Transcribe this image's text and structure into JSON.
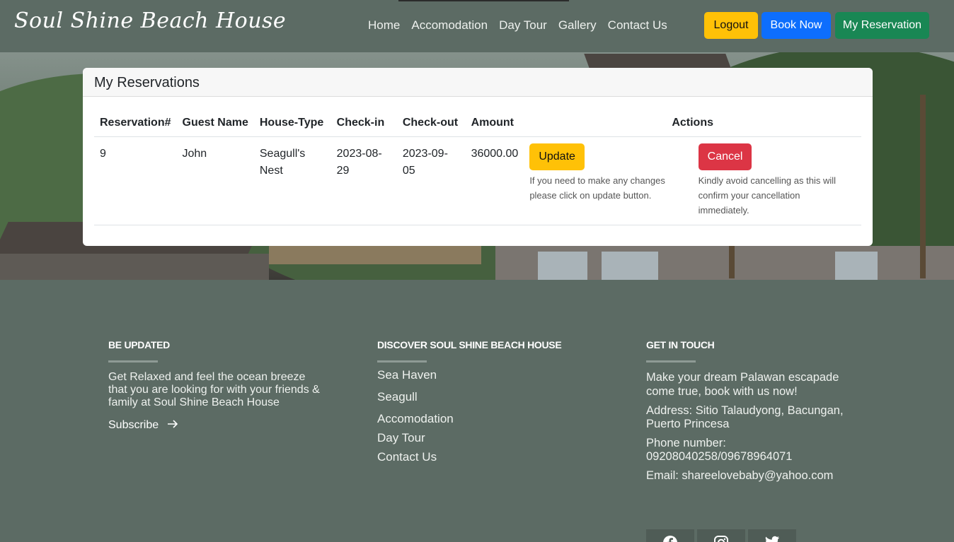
{
  "nav": {
    "brand": "Soul Shine Beach House",
    "links": [
      "Home",
      "Accomodation",
      "Day Tour",
      "Gallery",
      "Contact Us"
    ],
    "logout_label": "Logout",
    "book_label": "Book Now",
    "myres_label": "My Reservation"
  },
  "reservations": {
    "title": "My Reservations",
    "columns": [
      "Reservation#",
      "Guest Name",
      "House-Type",
      "Check-in",
      "Check-out",
      "Amount",
      "Actions"
    ],
    "rows": [
      {
        "id": "9",
        "guest": "John",
        "house_type": "Seagull's Nest",
        "check_in": "2023-08-29",
        "check_out": "2023-09-05",
        "amount": "36000.00",
        "update_label": "Update",
        "update_note": "If you need to make any changes please click on update button.",
        "cancel_label": "Cancel",
        "cancel_note": "Kindly avoid cancelling as this will confirm your cancellation immediately."
      }
    ]
  },
  "footer": {
    "col1": {
      "heading": "BE UPDATED",
      "text": "Get Relaxed and feel the ocean breeze that you are looking for with your friends & family at Soul Shine Beach House",
      "subscribe": "Subscribe"
    },
    "col2": {
      "heading": "DISCOVER SOUL SHINE BEACH HOUSE",
      "links": [
        "Sea Haven",
        "Seagull",
        "Accomodation",
        "Day Tour",
        "Contact Us"
      ]
    },
    "col3": {
      "heading": "GET IN TOUCH",
      "intro": "Make your dream Palawan escapade come true, book with us now!",
      "address": "Address: Sitio Talaudyong, Bacungan, Puerto Princesa",
      "phone": "Phone number: 09208040258/09678964071",
      "email": "Email: shareelovebaby@yahoo.com"
    },
    "social_icons": [
      "facebook-icon",
      "instagram-icon",
      "twitter-icon"
    ]
  },
  "colors": {
    "nav_bg": "#5c6b64",
    "logout": "#ffc107",
    "book": "#0d6efd",
    "my_reservation": "#198754",
    "cancel": "#dc3545"
  }
}
